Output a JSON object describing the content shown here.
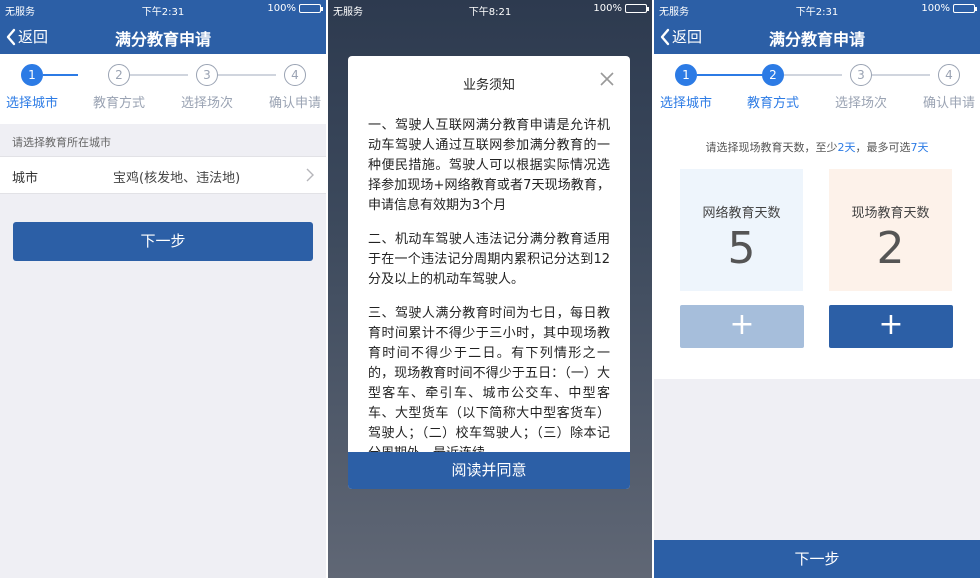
{
  "status_bar": {
    "carrier": "无服务",
    "time_1": "下午2:31",
    "time_2": "下午8:21",
    "time_3": "下午2:31",
    "battery": "100%"
  },
  "nav": {
    "back_label": "返回",
    "title": "满分教育申请"
  },
  "steps": [
    {
      "number": "1",
      "label": "选择城市"
    },
    {
      "number": "2",
      "label": "教育方式"
    },
    {
      "number": "3",
      "label": "选择场次"
    },
    {
      "number": "4",
      "label": "确认申请"
    }
  ],
  "city_screen": {
    "hint": "请选择教育所在城市",
    "city_label": "城市",
    "city_value": "宝鸡(核发地、违法地)",
    "next_button": "下一步"
  },
  "notice_modal": {
    "title": "业务须知",
    "paragraphs": [
      "一、驾驶人互联网满分教育申请是允许机动车驾驶人通过互联网参加满分教育的一种便民措施。驾驶人可以根据实际情况选择参加现场+网络教育或者7天现场教育，申请信息有效期为3个月",
      "二、机动车驾驶人违法记分满分教育适用于在一个违法记分周期内累积记分达到12分及以上的机动车驾驶人。",
      "三、驾驶人满分教育时间为七日，每日教育时间累计不得少于三小时，其中现场教育时间不得少于二日。有下列情形之一的，现场教育时间不得少于五日：（一）大型客车、牵引车、城市公交车、中型客车、大型货车（以下简称大中型客货车）驾驶人；（二）校车驾驶人；（三）除本记分周期外，最近连续"
    ],
    "agree_button": "阅读并同意"
  },
  "method_screen": {
    "hint_prefix": "请选择现场教育天数，至少",
    "hint_min": "2天",
    "hint_mid": "，最多可选",
    "hint_max": "7天",
    "online_label": "网络教育天数",
    "online_days": "5",
    "site_label": "现场教育天数",
    "site_days": "2",
    "plus_symbol": "+",
    "next_button": "下一步"
  },
  "colors": {
    "primary": "#2c5fa6",
    "accent": "#2c7be5",
    "online_card": "#eef5fc",
    "site_card": "#fdf2ea"
  }
}
